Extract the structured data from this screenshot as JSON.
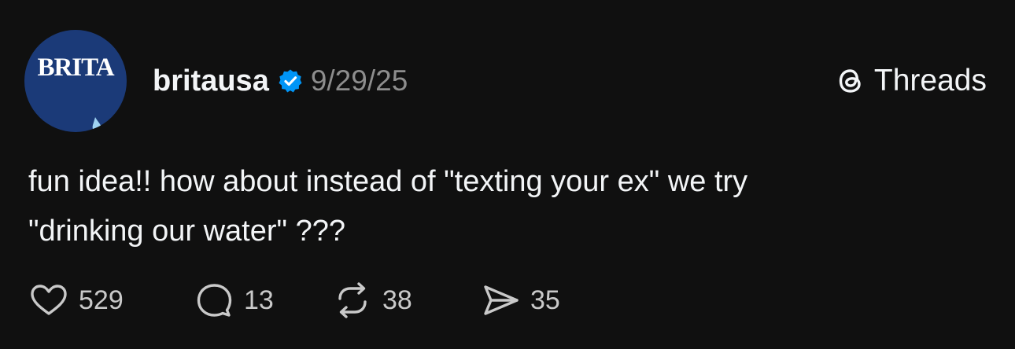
{
  "post": {
    "avatar_text": "BRITA",
    "username": "britausa",
    "date": "9/29/25",
    "platform_label": "Threads",
    "text_line_1": "fun idea!! how about instead of \"texting your ex\" we try",
    "text_line_2": "\"drinking our water\" ???"
  },
  "actions": {
    "likes": "529",
    "replies": "13",
    "reposts": "38",
    "shares": "35"
  },
  "icons": {
    "verified": "verified-badge-icon",
    "platform": "threads-logo-icon",
    "like": "heart-icon",
    "reply": "speech-bubble-icon",
    "repost": "repost-arrows-icon",
    "share": "paper-plane-icon"
  },
  "colors": {
    "background": "#101010",
    "text": "#f3f5f7",
    "muted": "#8d8d8d",
    "verified": "#0095f6",
    "brand_navy": "#1b3a78"
  }
}
